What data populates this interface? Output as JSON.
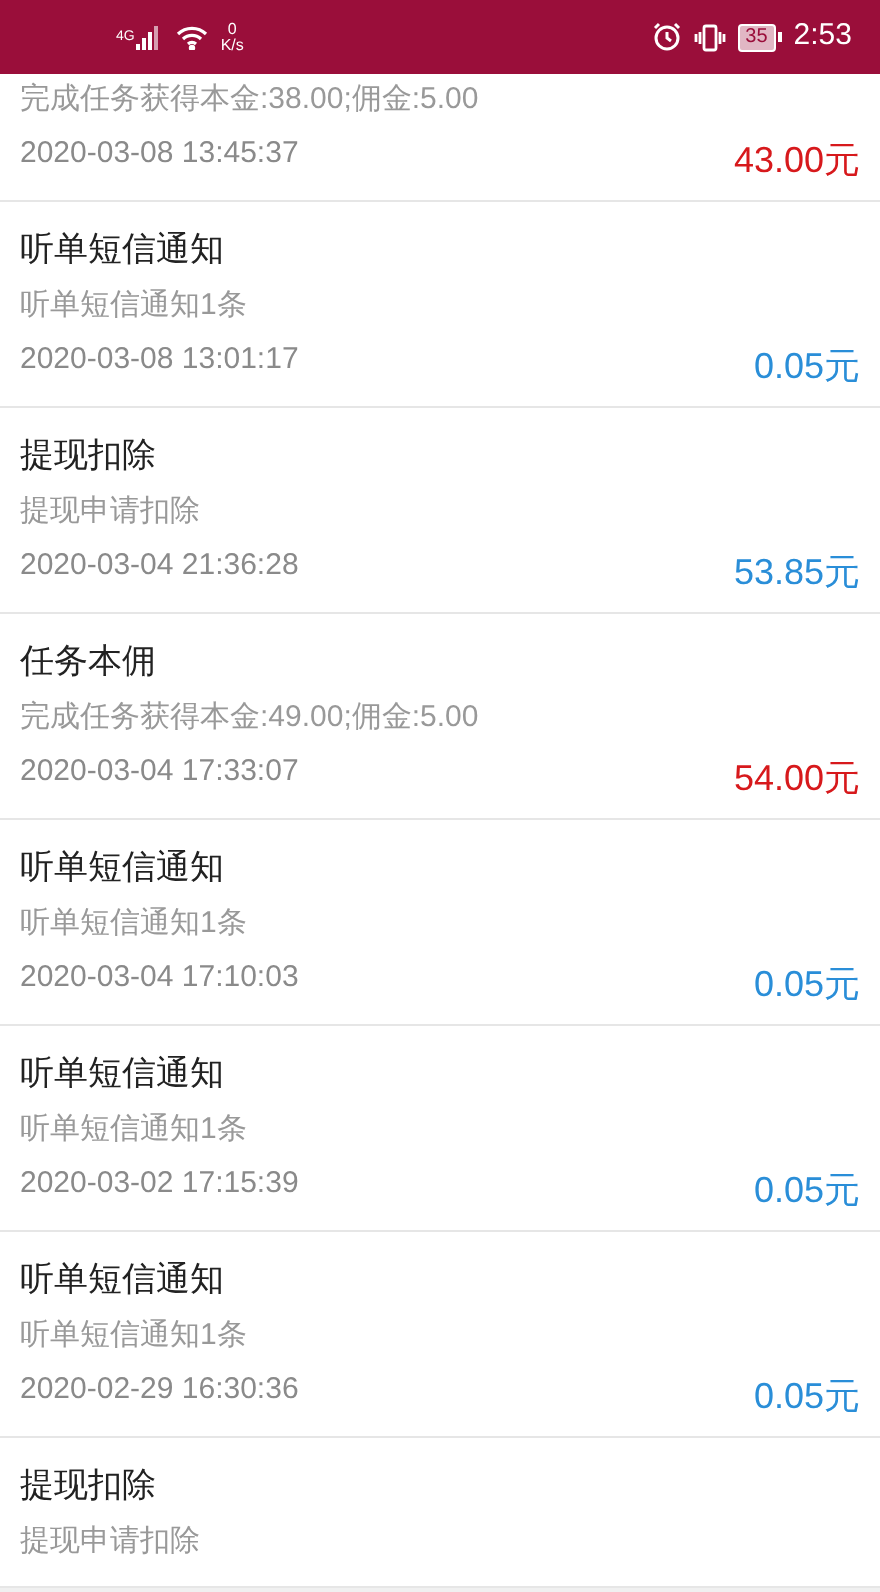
{
  "status_bar": {
    "network": "4G",
    "speed_value": "0",
    "speed_unit": "K/s",
    "battery": "35",
    "time": "2:53"
  },
  "records": [
    {
      "description": "完成任务获得本金:38.00;佣金:5.00",
      "time": "2020-03-08 13:45:37",
      "amount": "43.00元",
      "kind": "income"
    },
    {
      "title": "听单短信通知",
      "description": "听单短信通知1条",
      "time": "2020-03-08 13:01:17",
      "amount": "0.05元",
      "kind": "expense"
    },
    {
      "title": "提现扣除",
      "description": "提现申请扣除",
      "time": "2020-03-04 21:36:28",
      "amount": "53.85元",
      "kind": "expense"
    },
    {
      "title": "任务本佣",
      "description": "完成任务获得本金:49.00;佣金:5.00",
      "time": "2020-03-04 17:33:07",
      "amount": "54.00元",
      "kind": "income"
    },
    {
      "title": "听单短信通知",
      "description": "听单短信通知1条",
      "time": "2020-03-04 17:10:03",
      "amount": "0.05元",
      "kind": "expense"
    },
    {
      "title": "听单短信通知",
      "description": "听单短信通知1条",
      "time": "2020-03-02 17:15:39",
      "amount": "0.05元",
      "kind": "expense"
    },
    {
      "title": "听单短信通知",
      "description": "听单短信通知1条",
      "time": "2020-02-29 16:30:36",
      "amount": "0.05元",
      "kind": "expense"
    },
    {
      "title": "提现扣除",
      "description": "提现申请扣除",
      "kind": "expense"
    }
  ]
}
